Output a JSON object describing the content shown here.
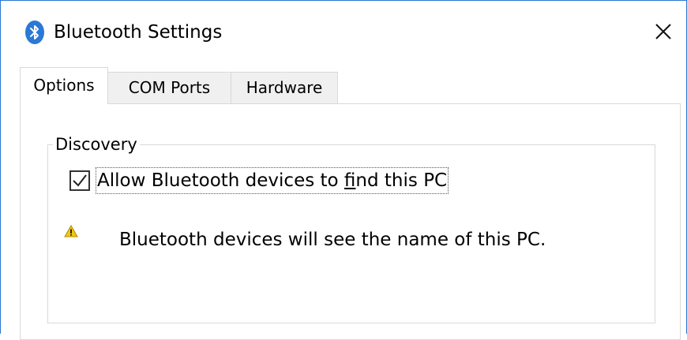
{
  "window": {
    "title": "Bluetooth Settings",
    "accent_color": "#2b78d6"
  },
  "tabs": [
    {
      "label": "Options",
      "active": true
    },
    {
      "label": "COM Ports",
      "active": false
    },
    {
      "label": "Hardware",
      "active": false
    }
  ],
  "discovery": {
    "group_label": "Discovery",
    "allow_find": {
      "label_before": "Allow Bluetooth devices to ",
      "label_mnemonic": "f",
      "label_after": "ind this PC",
      "checked": true
    },
    "warning_icon": "warning-icon",
    "warning_text": "Bluetooth devices will see the name of this PC."
  }
}
